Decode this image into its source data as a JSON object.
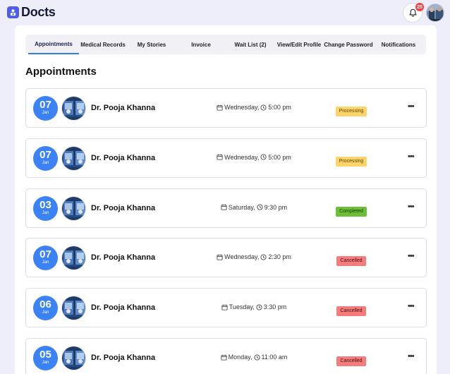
{
  "brand": {
    "name": "Docts"
  },
  "header": {
    "notification_count": "25"
  },
  "tabs": [
    {
      "label": "Appointments",
      "active": true
    },
    {
      "label": "Medical Records",
      "active": false
    },
    {
      "label": "My Stories",
      "active": false
    },
    {
      "label": "Invoice",
      "active": false
    },
    {
      "label": "Wait List (2)",
      "active": false
    },
    {
      "label": "View/Edit Profile",
      "active": false
    },
    {
      "label": "Change Password",
      "active": false
    },
    {
      "label": "Notifications",
      "active": false
    }
  ],
  "page": {
    "title": "Appointments"
  },
  "status_colors": {
    "Processing": {
      "bg": "#fcd46a",
      "fg": "#5a4300"
    },
    "Completed": {
      "bg": "#6dbf3a",
      "fg": "#173b00"
    },
    "Cancelled": {
      "bg": "#f47c7c",
      "fg": "#4a0c0c"
    }
  },
  "appointments": [
    {
      "day": "07",
      "month": "Jan",
      "doctor": "Dr. Pooja Khanna",
      "weekday": "Wednesday,",
      "time": "5:00 pm",
      "status": "Processing"
    },
    {
      "day": "07",
      "month": "Jan",
      "doctor": "Dr. Pooja Khanna",
      "weekday": "Wednesday,",
      "time": "5:00 pm",
      "status": "Processing"
    },
    {
      "day": "03",
      "month": "Jan",
      "doctor": "Dr. Pooja Khanna",
      "weekday": "Saturday,",
      "time": "9:30 pm",
      "status": "Completed"
    },
    {
      "day": "07",
      "month": "Jan",
      "doctor": "Dr. Pooja Khanna",
      "weekday": "Wednesday,",
      "time": "2:30 pm",
      "status": "Cancelled"
    },
    {
      "day": "06",
      "month": "Jan",
      "doctor": "Dr. Pooja Khanna",
      "weekday": "Tuesday,",
      "time": "3:30 pm",
      "status": "Cancelled"
    },
    {
      "day": "05",
      "month": "Jan",
      "doctor": "Dr. Pooja Khanna",
      "weekday": "Monday,",
      "time": "11:00 am",
      "status": "Cancelled"
    }
  ]
}
